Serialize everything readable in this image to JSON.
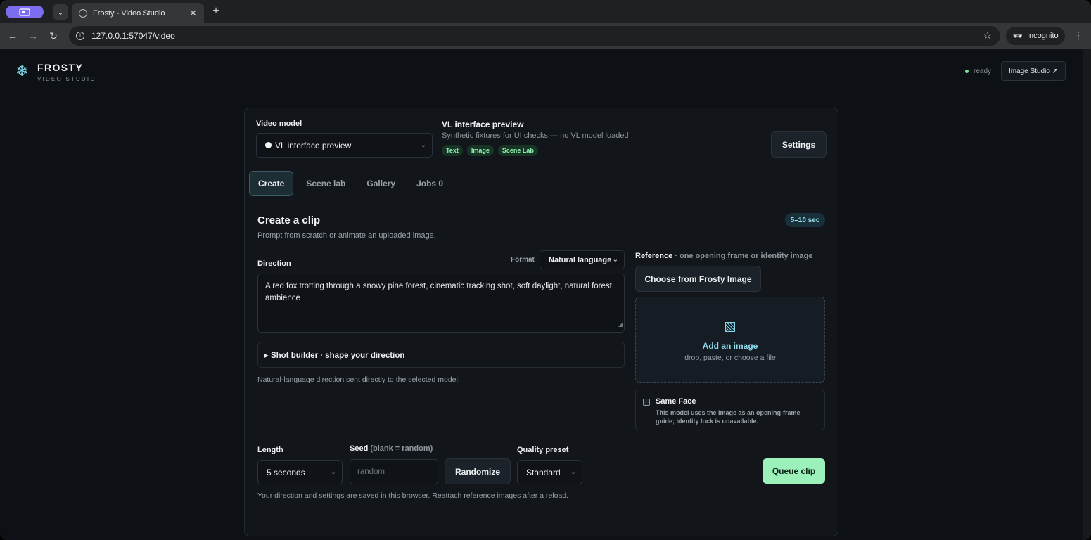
{
  "browser": {
    "tab_title": "Frosty - Video Studio",
    "url": "127.0.0.1:57047/video",
    "incognito_label": "Incognito",
    "new_tab": "+",
    "tab_close": "✕"
  },
  "header": {
    "logo": "❄",
    "brand": "FROSTY",
    "brand_sub": "VIDEO STUDIO",
    "status": "ready",
    "image_studio_link": "Image Studio ↗"
  },
  "model": {
    "label": "Video model",
    "selected": "VL interface preview",
    "info_title": "VL interface preview",
    "info_desc": "Synthetic fixtures for UI checks — no VL model loaded",
    "chips": [
      "Text",
      "Image",
      "Scene Lab"
    ],
    "settings_label": "Settings"
  },
  "tabs": [
    {
      "label": "Create",
      "active": true
    },
    {
      "label": "Scene lab",
      "active": false
    },
    {
      "label": "Gallery",
      "active": false
    },
    {
      "label": "Jobs 0",
      "active": false
    }
  ],
  "create": {
    "title": "Create a clip",
    "subtitle": "Prompt from scratch or animate an uploaded image.",
    "duration_badge": "5–10 sec",
    "direction_label": "Direction",
    "format_label": "Format",
    "format_value": "Natural language",
    "direction_text": "A red fox trotting through a snowy pine forest, cinematic tracking shot, soft daylight, natural forest ambience",
    "shot_builder": "▸ Shot builder · shape your direction",
    "direction_note": "Natural-language direction sent directly to the selected model."
  },
  "reference": {
    "title": "Reference",
    "title_suffix": " · one opening frame or identity image",
    "choose_button": "Choose from Frosty Image",
    "drop_title": "Add an image",
    "drop_sub": "drop, paste, or choose a file",
    "same_face_title": "Same Face",
    "same_face_desc": "This model uses the image as an opening-frame guide; identity lock is unavailable."
  },
  "controls": {
    "length_label": "Length",
    "length_value": "5 seconds",
    "seed_label": "Seed",
    "seed_hint": " (blank = random)",
    "seed_placeholder": "random",
    "randomize_label": "Randomize",
    "quality_label": "Quality preset",
    "quality_value": "Standard",
    "queue_label": "Queue clip",
    "persist_note": "Your direction and settings are saved in this browser. Reattach reference images after a reload."
  }
}
